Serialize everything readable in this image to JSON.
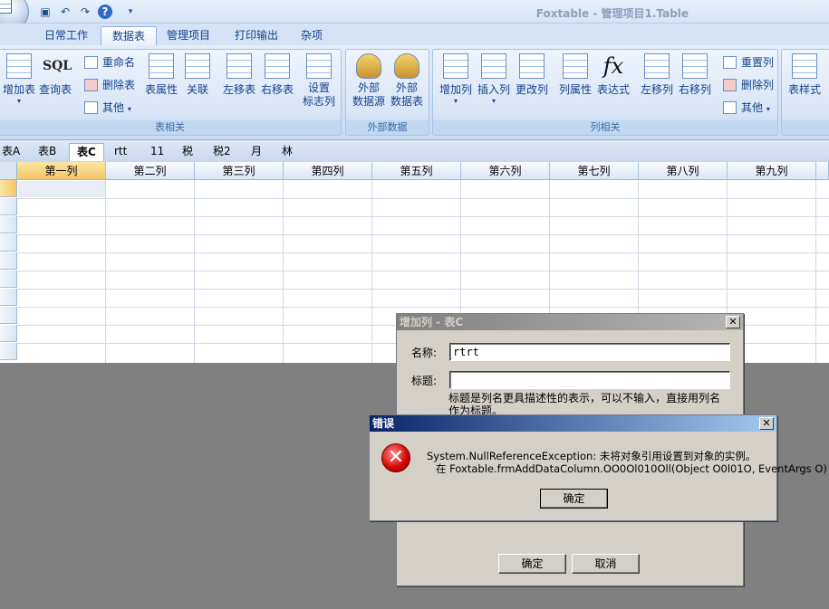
{
  "window": {
    "title": "Foxtable - 管理项目1.Table"
  },
  "quick_access": [
    "save-icon",
    "undo-icon",
    "redo-icon",
    "help-icon",
    "customize-icon"
  ],
  "tabs": [
    "日常工作",
    "数据表",
    "管理项目",
    "打印输出",
    "杂项"
  ],
  "active_tab": "数据表",
  "ribbon": {
    "table_group": {
      "label": "表相关",
      "add_table": "增加表",
      "query_table": "查询表",
      "sql_icon": "SQL",
      "rename": "重命名",
      "delete_table": "删除表",
      "other": "其他",
      "table_props": "表属性",
      "relation": "关联",
      "move_left": "左移表",
      "move_right": "右移表",
      "set_flag_col": "设置\n标志列"
    },
    "external_group": {
      "label": "外部数据",
      "ext_source": "外部\n数据源",
      "ext_table": "外部\n数据表"
    },
    "column_group": {
      "label": "列相关",
      "add_col": "增加列",
      "insert_col": "插入列",
      "modify_col": "更改列",
      "col_props": "列属性",
      "expression": "表达式",
      "fx_icon": "fx",
      "move_left": "左移列",
      "move_right": "右移列",
      "reset_col": "重置列",
      "delete_col": "删除列",
      "other": "其他"
    },
    "style_group": {
      "table_style": "表样式"
    }
  },
  "sheet_tabs": [
    "表A",
    "表B",
    "表C",
    "rtt",
    "11",
    "税",
    "税2",
    "月",
    "林"
  ],
  "active_sheet": "表C",
  "grid": {
    "columns": [
      "第一列",
      "第二列",
      "第三列",
      "第四列",
      "第五列",
      "第六列",
      "第七列",
      "第八列",
      "第九列"
    ]
  },
  "add_column_dialog": {
    "title": "增加列 - 表C",
    "name_label": "名称:",
    "name_value": "rtrt",
    "caption_label": "标题:",
    "caption_value": "",
    "hint": "标题是列名更具描述性的表示，可以不输入，直接用列名\n作为标题。",
    "ok": "确定",
    "cancel": "取消"
  },
  "error_dialog": {
    "title": "错误",
    "message_line1": "System.NullReferenceException: 未将对象引用设置到对象的实例。",
    "message_line2": "在 Foxtable.frmAddDataColumn.OO0Ol010Oll(Object O0l01O, EventArgs O)",
    "ok": "确定",
    "colors": {
      "title_bar": "#0a246a",
      "icon": "#d10000"
    }
  }
}
